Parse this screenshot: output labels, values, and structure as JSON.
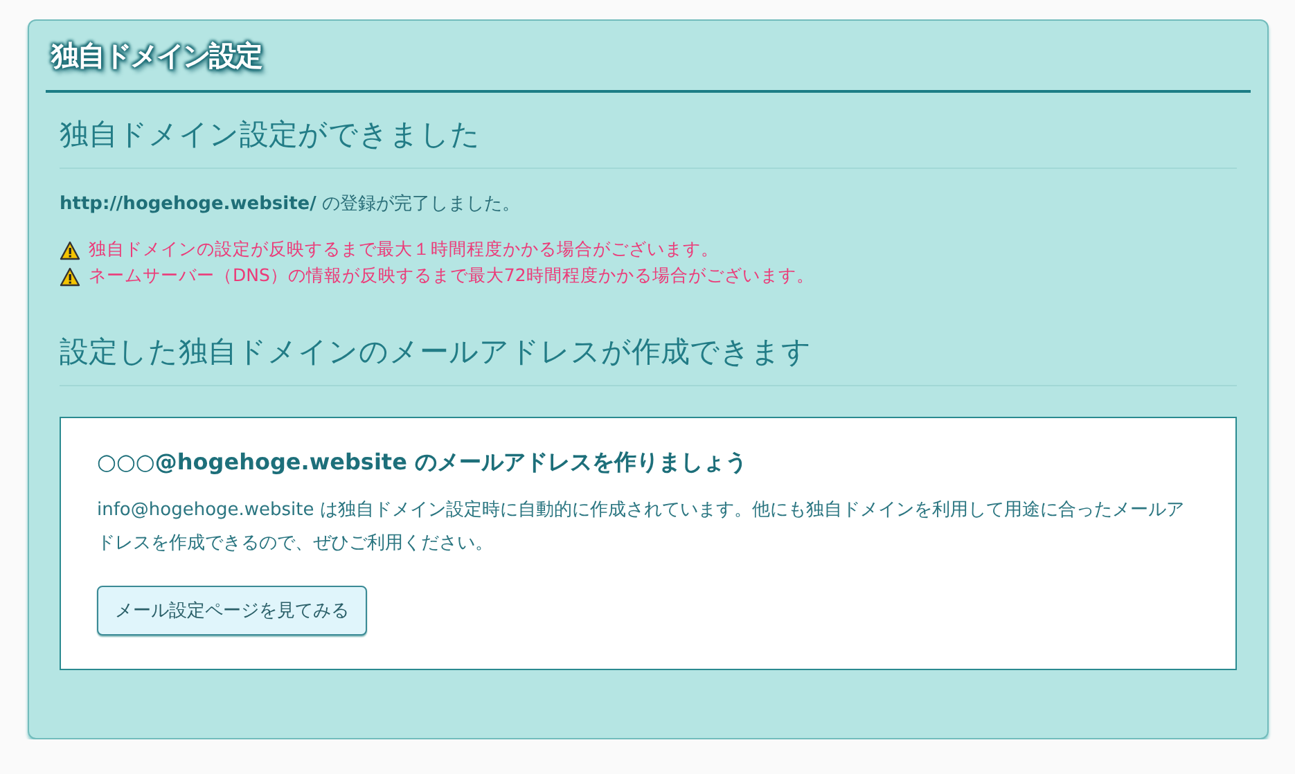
{
  "panel": {
    "title": "独自ドメイン設定"
  },
  "done": {
    "heading": "独自ドメイン設定ができました",
    "message": "**http://hogehoge.website/** の登録が完了しました。",
    "warnings": [
      "独自ドメインの設定が反映するまで最大１時間程度かかる場合がございます。",
      "ネームサーバー（DNS）の情報が反映するまで最大72時間程度かかる場合がございます。"
    ]
  },
  "mail": {
    "heading": "設定した独自ドメインのメールアドレスが作成できます",
    "card_title": "○○○@hogehoge.website のメールアドレスを作りましょう",
    "description": "info@hogehoge.website は独自ドメイン設定時に自動的に作成されています。他にも独自ドメインを利用して用途に合ったメールアドレスを作成できるので、ぜひご利用ください。",
    "button": "メール設定ページを見てみる"
  }
}
